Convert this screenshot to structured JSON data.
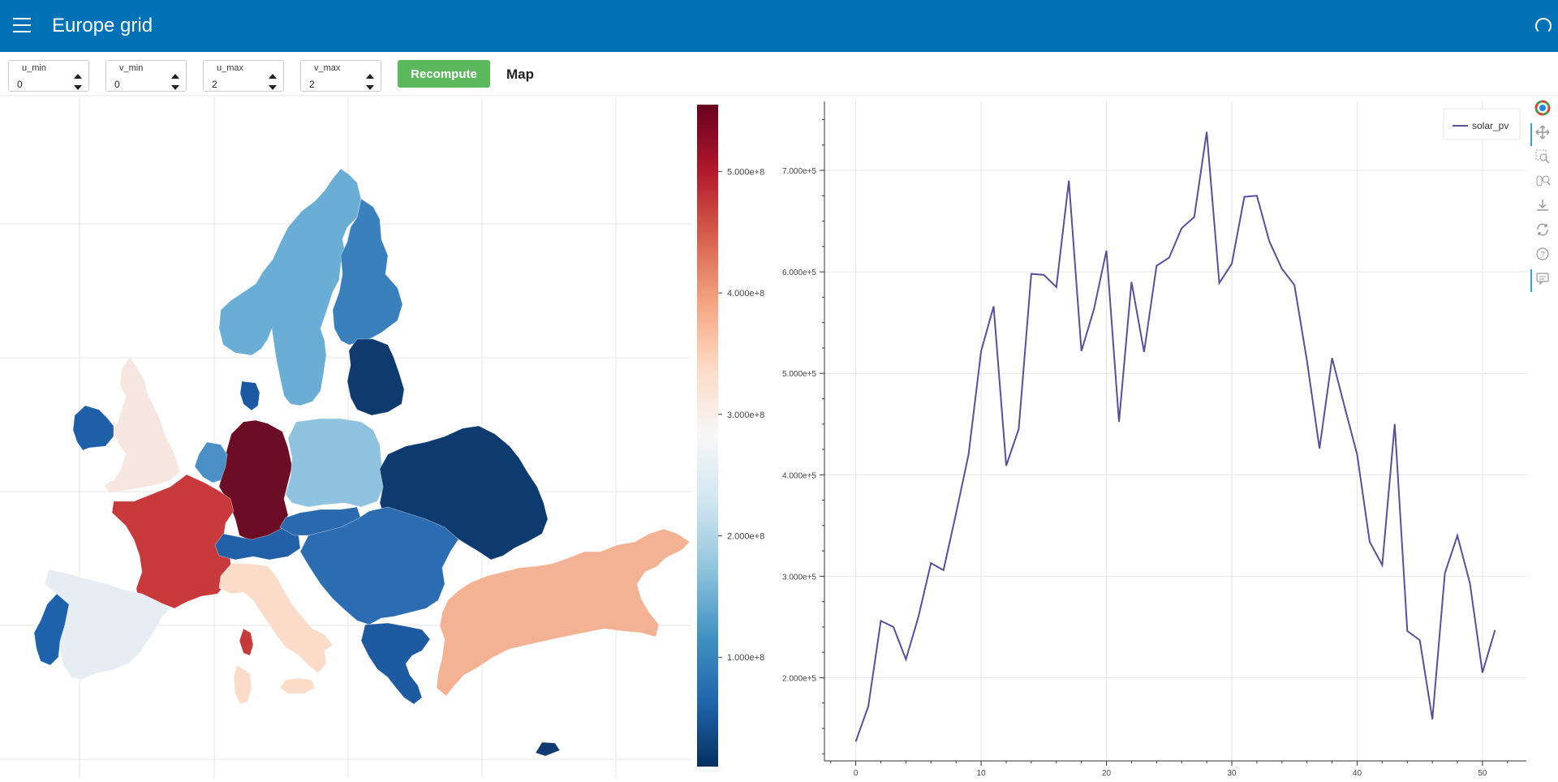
{
  "header": {
    "title": "Europe grid"
  },
  "controls": {
    "u_min": {
      "label": "u_min",
      "value": "0"
    },
    "v_min": {
      "label": "v_min",
      "value": "0"
    },
    "u_max": {
      "label": "u_max",
      "value": "2"
    },
    "v_max": {
      "label": "v_max",
      "value": "2"
    },
    "recompute_label": "Recompute",
    "map_label": "Map"
  },
  "colorbar": {
    "ticks": [
      "1.000e+8",
      "2.000e+8",
      "3.000e+8",
      "4.000e+8",
      "5.000e+8"
    ],
    "tick_values": [
      100000000,
      200000000,
      300000000,
      400000000,
      500000000
    ],
    "range": [
      10000000,
      555000000
    ],
    "colors": [
      "#053061",
      "#2166ac",
      "#4393c3",
      "#92c5de",
      "#d1e5f0",
      "#f7f7f7",
      "#fddbc7",
      "#f4a582",
      "#d6604d",
      "#b2182b",
      "#67001f"
    ]
  },
  "chart_data": {
    "type": "line",
    "series": [
      {
        "name": "solar_pv",
        "color": "#5b4e9c",
        "x": [
          0,
          1,
          2,
          3,
          4,
          5,
          6,
          7,
          8,
          9,
          10,
          11,
          12,
          13,
          14,
          15,
          16,
          17,
          18,
          19,
          20,
          21,
          22,
          23,
          24,
          25,
          26,
          27,
          28,
          29,
          30,
          31,
          32,
          33,
          34,
          35,
          36,
          37,
          38,
          39,
          40,
          41,
          42,
          43,
          44,
          45,
          46,
          47,
          48,
          49,
          50,
          51
        ],
        "values": [
          137000,
          172000,
          256000,
          250000,
          218000,
          260000,
          313000,
          306000,
          362000,
          420000,
          522000,
          566000,
          409000,
          445000,
          598000,
          597000,
          585000,
          690000,
          522000,
          563000,
          621000,
          452000,
          590000,
          521000,
          606000,
          614000,
          643000,
          654000,
          738000,
          589000,
          608000,
          674000,
          675000,
          630000,
          603000,
          587000,
          512000,
          426000,
          515000,
          467000,
          420000,
          334000,
          311000,
          450000,
          246000,
          237000,
          159000,
          303000,
          340000,
          293000,
          205000,
          247000
        ]
      }
    ],
    "xticks": [
      "0",
      "10",
      "20",
      "30",
      "40",
      "50"
    ],
    "xtick_values": [
      0,
      10,
      20,
      30,
      40,
      50
    ],
    "yticks": [
      "2.000e+5",
      "3.000e+5",
      "4.000e+5",
      "5.000e+5",
      "6.000e+5",
      "7.000e+5"
    ],
    "ytick_values": [
      200000,
      300000,
      400000,
      500000,
      600000,
      700000
    ],
    "xlim": [
      -2.5,
      53.5
    ],
    "ylim": [
      118000,
      768000
    ],
    "legend": "top-right",
    "grid": true
  },
  "map": {
    "regions": [
      {
        "name": "Norway-Sweden",
        "color": "#6aaed6"
      },
      {
        "name": "Finland",
        "color": "#3a80bd"
      },
      {
        "name": "UK",
        "color": "#f5e6e0"
      },
      {
        "name": "Ireland",
        "color": "#1f5fa8"
      },
      {
        "name": "Germany",
        "color": "#6b0d24"
      },
      {
        "name": "France",
        "color": "#c7393a"
      },
      {
        "name": "Spain",
        "color": "#e6eef3"
      },
      {
        "name": "Portugal",
        "color": "#1e62ac"
      },
      {
        "name": "Italy",
        "color": "#fbdcc8"
      },
      {
        "name": "Poland",
        "color": "#8fc2de"
      },
      {
        "name": "Ukraine-Belarus",
        "color": "#0d3b70"
      },
      {
        "name": "Baltics",
        "color": "#0f3a6e"
      },
      {
        "name": "Turkey",
        "color": "#f4b294"
      },
      {
        "name": "Balkans",
        "color": "#2c6cb0"
      },
      {
        "name": "Greece",
        "color": "#1e5aa0"
      },
      {
        "name": "Denmark",
        "color": "#1b5aa3"
      },
      {
        "name": "Benelux",
        "color": "#4a8fc6"
      },
      {
        "name": "Switzerland-Austria",
        "color": "#215fa7"
      }
    ]
  }
}
